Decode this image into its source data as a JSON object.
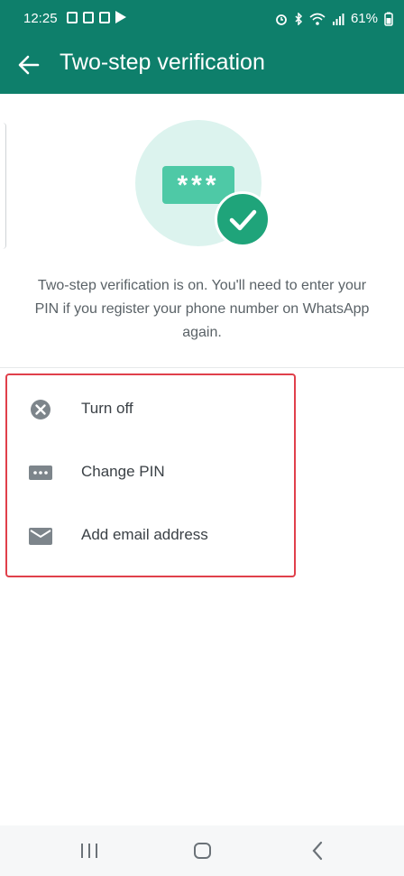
{
  "status_bar": {
    "time": "12:25",
    "battery": "61%"
  },
  "header": {
    "title": "Two-step verification"
  },
  "hero": {
    "pin_mask": "***"
  },
  "description": "Two-step verification is on. You'll need to enter your PIN if you register your phone number on WhatsApp again.",
  "options": [
    {
      "label": "Turn off",
      "icon": "close-circle-icon"
    },
    {
      "label": "Change PIN",
      "icon": "pin-dots-icon"
    },
    {
      "label": "Add email address",
      "icon": "mail-icon"
    }
  ],
  "colors": {
    "brand": "#0e7f6b",
    "accent": "#1fa47a",
    "highlight_border": "#e0404b"
  }
}
